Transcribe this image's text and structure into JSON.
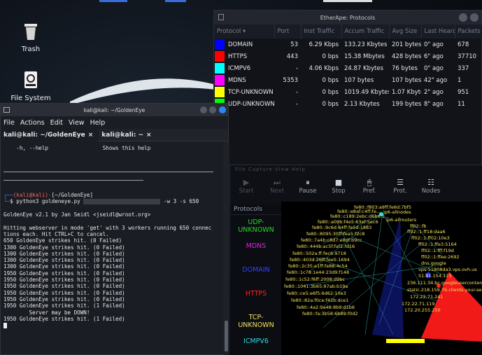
{
  "desktop": {
    "icons": [
      {
        "label": "Trash",
        "icon": "trash-icon"
      },
      {
        "label": "File System",
        "icon": "drive-icon"
      }
    ]
  },
  "protocols_window": {
    "title": "EtherApe: Protocols",
    "columns": [
      "Protocol",
      "Port",
      "Inst Traffic",
      "Accum Traffic",
      "Avg Size",
      "Last Heard",
      "Packets"
    ],
    "rows": [
      {
        "color": "#0000ff",
        "protocol": "DOMAIN",
        "port": "53",
        "inst": "6.29 Kbps",
        "accum": "133.23 Kbytes",
        "avg": "201 bytes",
        "last": "0\" ago",
        "packets": "678"
      },
      {
        "color": "#ff0000",
        "protocol": "HTTPS",
        "port": "443",
        "inst": "0 bps",
        "accum": "15.38 Mbytes",
        "avg": "428 bytes",
        "last": "6\" ago",
        "packets": "37710"
      },
      {
        "color": "#00ffff",
        "protocol": "ICMPV6",
        "port": "-",
        "inst": "4.06 Kbps",
        "accum": "24.87 Kbytes",
        "avg": "76 bytes",
        "last": "0\" ago",
        "packets": "337"
      },
      {
        "color": "#ff00ff",
        "protocol": "MDNS",
        "port": "5353",
        "inst": "0 bps",
        "accum": "107 bytes",
        "avg": "107 bytes",
        "last": "42\" ago",
        "packets": "1"
      },
      {
        "color": "#ffff00",
        "protocol": "TCP-UNKNOWN",
        "port": "-",
        "inst": "0 bps",
        "accum": "1019.49 Kbytes",
        "avg": "1.07 Kbytes",
        "last": "2\" ago",
        "packets": "951"
      },
      {
        "color": "#00ff00",
        "protocol": "UDP-UNKNOWN",
        "port": "-",
        "inst": "0 bps",
        "accum": "2.13 Kbytes",
        "avg": "199 bytes",
        "last": "8\" ago",
        "packets": "11"
      }
    ]
  },
  "etherape_main": {
    "menu_ghost": "File  Capture  View  Help",
    "toolbar": [
      {
        "label": "Start",
        "glyph": "▶",
        "enabled": false
      },
      {
        "label": "Next",
        "glyph": "⏭",
        "enabled": false
      },
      {
        "label": "Pause",
        "glyph": "⏸",
        "enabled": true
      },
      {
        "label": "Stop",
        "glyph": "■",
        "enabled": true
      },
      {
        "label": "Pref.",
        "glyph": "🖱",
        "enabled": true
      },
      {
        "label": "Prot.",
        "glyph": "☰",
        "enabled": true
      },
      {
        "label": "Nodes",
        "glyph": "☷",
        "enabled": true
      }
    ],
    "protocols_header": "Protocols",
    "protocol_list": [
      {
        "name": "UDP-UNKNOWN",
        "color": "#22dd22"
      },
      {
        "name": "MDNS",
        "color": "#dd22dd"
      },
      {
        "name": "DOMAIN",
        "color": "#3344ff"
      },
      {
        "name": "HTTPS",
        "color": "#ff2222"
      },
      {
        "name": "TCP-UNKNOWN",
        "color": "#f2e35c"
      },
      {
        "name": "ICMPV6",
        "color": "#33dddd"
      }
    ],
    "nodes": [
      "fe80::f803:a9ff:fe6d:7bf5",
      "fe80::e8af:c4ff:fe...",
      "ip6-allnodes",
      "fe80::c189:2ebc:d6b6:1...",
      "ip6-allrouters",
      "fe80::a09b:f4e5:63ef:5ec6",
      "ff02::fb",
      "fe80::9c6d:64ff:fe5d:1883",
      "ff02::1:ff18:daa6",
      "fe80::8095:30ff:fea5:f2c8",
      "ff02::1:ff02:10e3",
      "fe80::7a4b:c8d7:e8df:b9cc",
      "ff02::1:ffe3:5164",
      "fe80::444b:ac5f:faf2:fd16",
      "ff02::1:fff:f19d",
      "fe80::502a:ff:fec6:9718",
      "ff02::1:ffee:2692",
      "fe80::403d:26ff:fee5:1694",
      "dns.google",
      "fe80::2c35:e1ff:fe88:4c54",
      "vps-51808da3.vps.ovh.us",
      "fe80::1c78:1e44:23d9:f148",
      "51.81.154.173",
      "fe80::1c52:f6ff:2008:d9bc",
      "236.111.34.bc.googleusercontent.c...",
      "fe80::1041:3b65:97ab:b19a",
      "static.218.159.76.clients.your-server.de",
      "fe80::ce5:e6f5:6d62:10e3",
      "172.22.71.241",
      "fe80::82a:f0ce:f42b:dce1",
      "172.22.71.119",
      "fe80::4a2:9a48:8b9:d1b6",
      "172.20.255.250",
      "fe80::fa:3b58:6b89:f0d2"
    ]
  },
  "terminal": {
    "title": "kali@kali: ~/GoldenEye",
    "menu": [
      "File",
      "Actions",
      "Edit",
      "View",
      "Help"
    ],
    "tabs": [
      {
        "label": "kali@kali: ~/GoldenEye",
        "active": true
      },
      {
        "label": "kali@kali: ~",
        "active": false
      }
    ],
    "help_line": "    -h, --help                 Shows this help",
    "prompt_user": "(kali@kali)",
    "prompt_path": "[~/GoldenEye]",
    "command_prefix": "$ python3 goldeneye.py ",
    "command_suffix": " -w 3 -s 650",
    "lines": [
      "GoldenEye v2.1 by Jan Seidl <jseidl@wroot.org>",
      "",
      "Hitting webserver in mode 'get' with 3 workers running 650 connec",
      "tions each. Hit CTRL+C to cancel.",
      "650 GoldenEye strikes hit. (0 Failed)",
      "1300 GoldenEye strikes hit. (0 Failed)",
      "1300 GoldenEye strikes hit. (0 Failed)",
      "1300 GoldenEye strikes hit. (0 Failed)",
      "1300 GoldenEye strikes hit. (0 Failed)",
      "1950 GoldenEye strikes hit. (0 Failed)",
      "1950 GoldenEye strikes hit. (0 Failed)",
      "1950 GoldenEye strikes hit. (0 Failed)",
      "1950 GoldenEye strikes hit. (0 Failed)",
      "1950 GoldenEye strikes hit. (0 Failed)",
      "1950 GoldenEye strikes hit. (1 Failed)",
      "        Server may be DOWN!",
      "1950 GoldenEye strikes hit. (1 Failed)"
    ]
  }
}
